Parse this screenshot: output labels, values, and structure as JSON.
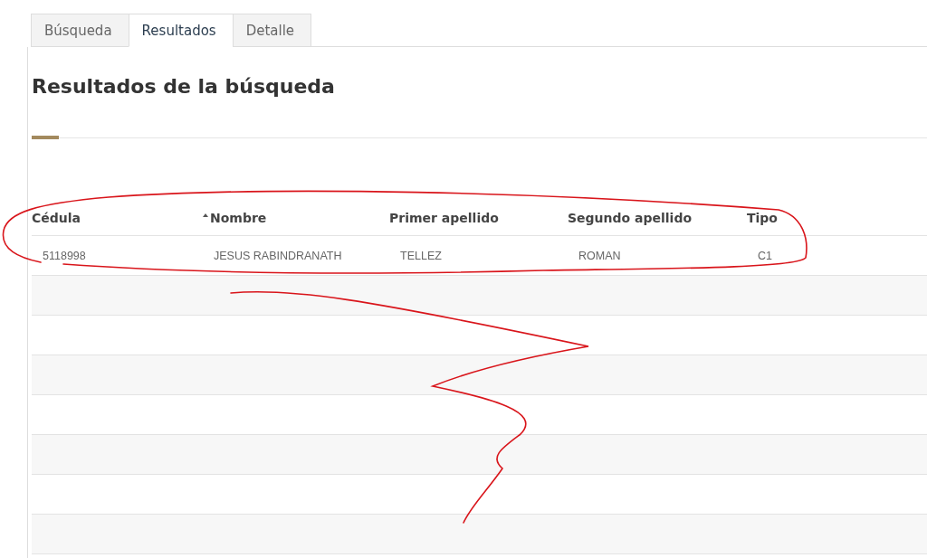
{
  "tabs": [
    {
      "label": "Búsqueda",
      "selected": false
    },
    {
      "label": "Resultados",
      "selected": true
    },
    {
      "label": "Detalle",
      "selected": false
    }
  ],
  "heading": "Resultados de la búsqueda",
  "table": {
    "columns": [
      {
        "label": "Cédula",
        "sorted": false
      },
      {
        "label": "Nombre",
        "sorted": true
      },
      {
        "label": "Primer apellido",
        "sorted": false
      },
      {
        "label": "Segundo apellido",
        "sorted": false
      },
      {
        "label": "Tipo",
        "sorted": false
      }
    ],
    "rows": [
      [
        "5118998",
        "JESUS RABINDRANATH",
        "TELLEZ",
        "ROMAN",
        "C1"
      ]
    ]
  }
}
